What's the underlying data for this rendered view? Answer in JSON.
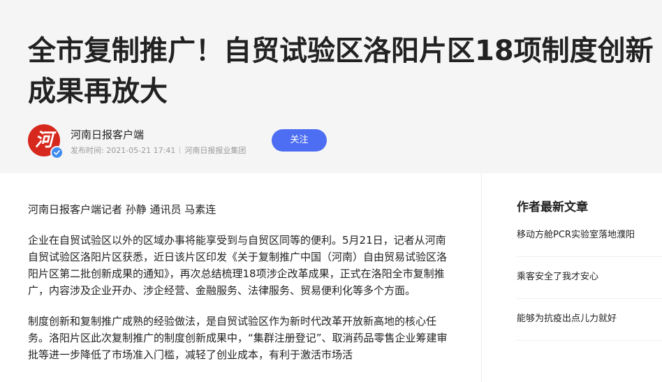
{
  "article": {
    "title_line1": "全市复制推广！自贸试验区洛阳片区18项制度创新",
    "title_line2": "成果再放大",
    "author": {
      "name": "河南日报客户端",
      "avatar_glyph": "河",
      "publish_label": "发布时间: 2021-05-21 17:41",
      "source": "河南日报报业集团",
      "follow_label": "关注"
    },
    "byline": "河南日报客户端记者 孙静 通讯员 马素连",
    "paragraphs": [
      "企业在自贸试验区以外的区域办事将能享受到与自贸区同等的便利。5月21日，记者从河南自贸试验区洛阳片区获悉，近日该片区印发《关于复制推广中国（河南）自由贸易试验区洛阳片区第二批创新成果的通知》，再次总结梳理18项涉企改革成果，正式在洛阳全市复制推广，内容涉及企业开办、涉企经营、金融服务、法律服务、贸易便利化等多个方面。",
      "制度创新和复制推广成熟的经验做法，是自贸试验区作为新时代改革开放新高地的核心任务。洛阳片区此次复制推广的制度创新成果中，“集群注册登记”、取消药品零售企业筹建审批等进一步降低了市场准入门槛，减轻了创业成本，有利于激活市场活"
    ]
  },
  "sidebar": {
    "title": "作者最新文章",
    "items": [
      "移动方舱PCR实验室落地濮阳",
      "乘客安全了我才安心",
      "能够为抗疫出点儿力就好"
    ]
  },
  "colors": {
    "header_bg": "#f5f5f6",
    "follow_button": "#4d6ef2",
    "avatar_red": "#d7281d",
    "verified_blue": "#3f8cf0"
  }
}
